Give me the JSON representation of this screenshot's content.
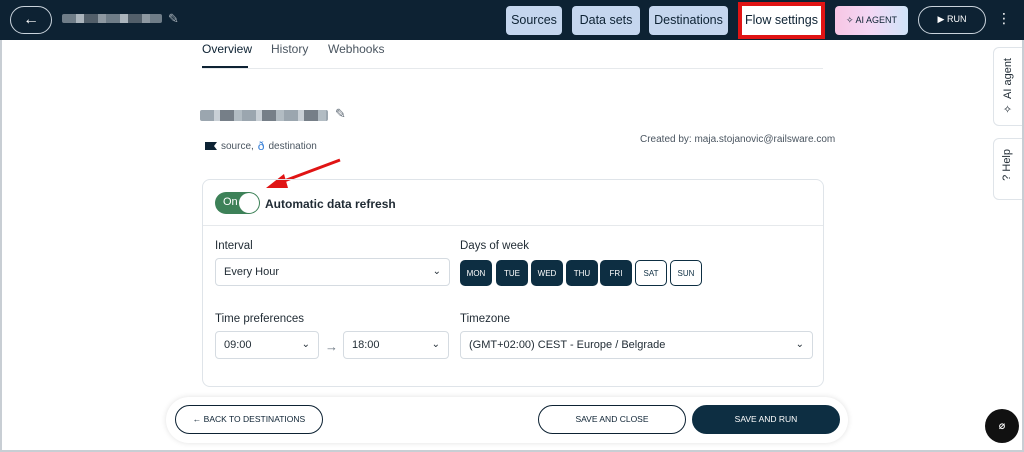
{
  "topbar": {
    "back_icon": "arrow-left-icon",
    "back_glyph": "←",
    "edit_icon": "pencil-icon",
    "pencil_glyph": "✎",
    "nav": [
      "Sources",
      "Data sets",
      "Destinations",
      "Flow settings"
    ],
    "ai_agent_label": "AI AGENT",
    "ai_glyph": "✧",
    "run_label": "RUN",
    "run_glyph": "▶",
    "more_icon": "kebab-icon",
    "kebab_glyph": "⋮"
  },
  "tabs": [
    "Overview",
    "History",
    "Webhooks"
  ],
  "legend": {
    "source": "source,",
    "destination": "destination",
    "destination_glyph": "ð"
  },
  "created_by": "Created by: maja.stojanovic@railsware.com",
  "refresh_card": {
    "toggle_label": "On",
    "title": "Automatic data refresh",
    "interval_label": "Interval",
    "interval_value": "Every Hour",
    "days_label": "Days of week",
    "days": [
      {
        "label": "MON",
        "selected": true
      },
      {
        "label": "TUE",
        "selected": true
      },
      {
        "label": "WED",
        "selected": true
      },
      {
        "label": "THU",
        "selected": true
      },
      {
        "label": "FRI",
        "selected": true
      },
      {
        "label": "SAT",
        "selected": false
      },
      {
        "label": "SUN",
        "selected": false
      }
    ],
    "time_label": "Time preferences",
    "time_from": "09:00",
    "time_to": "18:00",
    "arrow_glyph": "→",
    "chevron_glyph": "⌄",
    "timezone_label": "Timezone",
    "timezone_value": "(GMT+02:00) CEST - Europe / Belgrade"
  },
  "bottom": {
    "back_label": "BACK TO DESTINATIONS",
    "back_glyph": "←",
    "save_close": "SAVE AND CLOSE",
    "save_run": "SAVE AND RUN"
  },
  "side_tabs": [
    "AI agent",
    "Help"
  ],
  "side_glyphs": [
    "✧",
    "?"
  ],
  "fab_glyph": "⌀",
  "colors": {
    "nav_dark": "#0d2233",
    "nav_button": "#c5d6ee",
    "highlight_box": "#e01414",
    "toggle_on": "#3d8158",
    "primary": "#0d2e42"
  }
}
